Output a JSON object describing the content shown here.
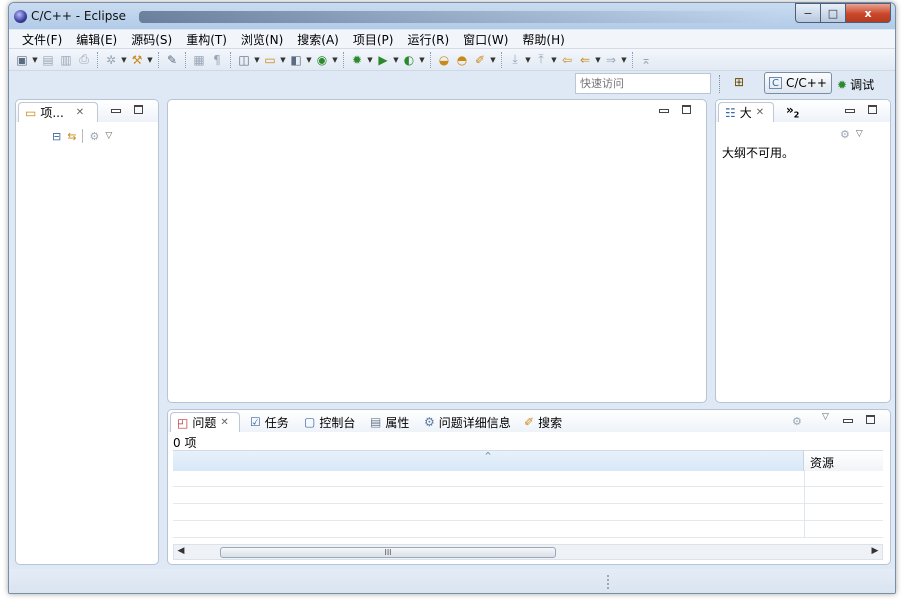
{
  "window": {
    "title": "C/C++  -  Eclipse",
    "controls": {
      "minimize": "−",
      "maximize": "□",
      "close": "x"
    }
  },
  "menu": [
    "文件(F)",
    "编辑(E)",
    "源码(S)",
    "重构(T)",
    "浏览(N)",
    "搜索(A)",
    "项目(P)",
    "运行(R)",
    "窗口(W)",
    "帮助(H)"
  ],
  "toolbar": {
    "icons": [
      "new-icon",
      "save-icon",
      "save-all-icon",
      "print-icon",
      "build-icon",
      "build-config-icon",
      "toggle-mark-icon",
      "toggle-block-icon",
      "pilcrow-icon",
      "new-cpp-project-icon",
      "new-folder-icon",
      "new-source-icon",
      "new-class-icon",
      "debug-icon",
      "run-icon",
      "external-tools-icon",
      "open-type-icon",
      "open-folder-icon",
      "search-pen-icon",
      "next-annotation-icon",
      "prev-annotation-icon",
      "last-edit-icon",
      "back-icon",
      "forward-icon",
      "pin-icon"
    ]
  },
  "quick_access": {
    "placeholder": "快速访问"
  },
  "perspectives": {
    "open_icon": "open-perspective-icon",
    "cpp_label": "C/C++",
    "debug_label": "调试"
  },
  "project_explorer": {
    "tab_label": "项...",
    "close": "✕"
  },
  "outline": {
    "tab_label": "大",
    "close": "✕",
    "overflow_label": "»",
    "overflow_count": "2",
    "message": "大纲不可用。"
  },
  "bottom_panel": {
    "tabs": [
      {
        "label": "问题",
        "icon": "problems-icon",
        "closable": true
      },
      {
        "label": "任务",
        "icon": "tasks-icon"
      },
      {
        "label": "控制台",
        "icon": "console-icon"
      },
      {
        "label": "属性",
        "icon": "properties-icon"
      },
      {
        "label": "问题详细信息",
        "icon": "problem-details-icon"
      },
      {
        "label": "搜索",
        "icon": "search-icon"
      }
    ],
    "count_text": "0 项",
    "table": {
      "sort_indicator": "^",
      "columns": [
        "",
        "资源"
      ],
      "rows": 5
    },
    "scroll_thumb": "III"
  },
  "colors": {
    "window_frame": "#dfe9f5",
    "close_button": "#c9472a",
    "panel_border": "#b7c4d4"
  }
}
